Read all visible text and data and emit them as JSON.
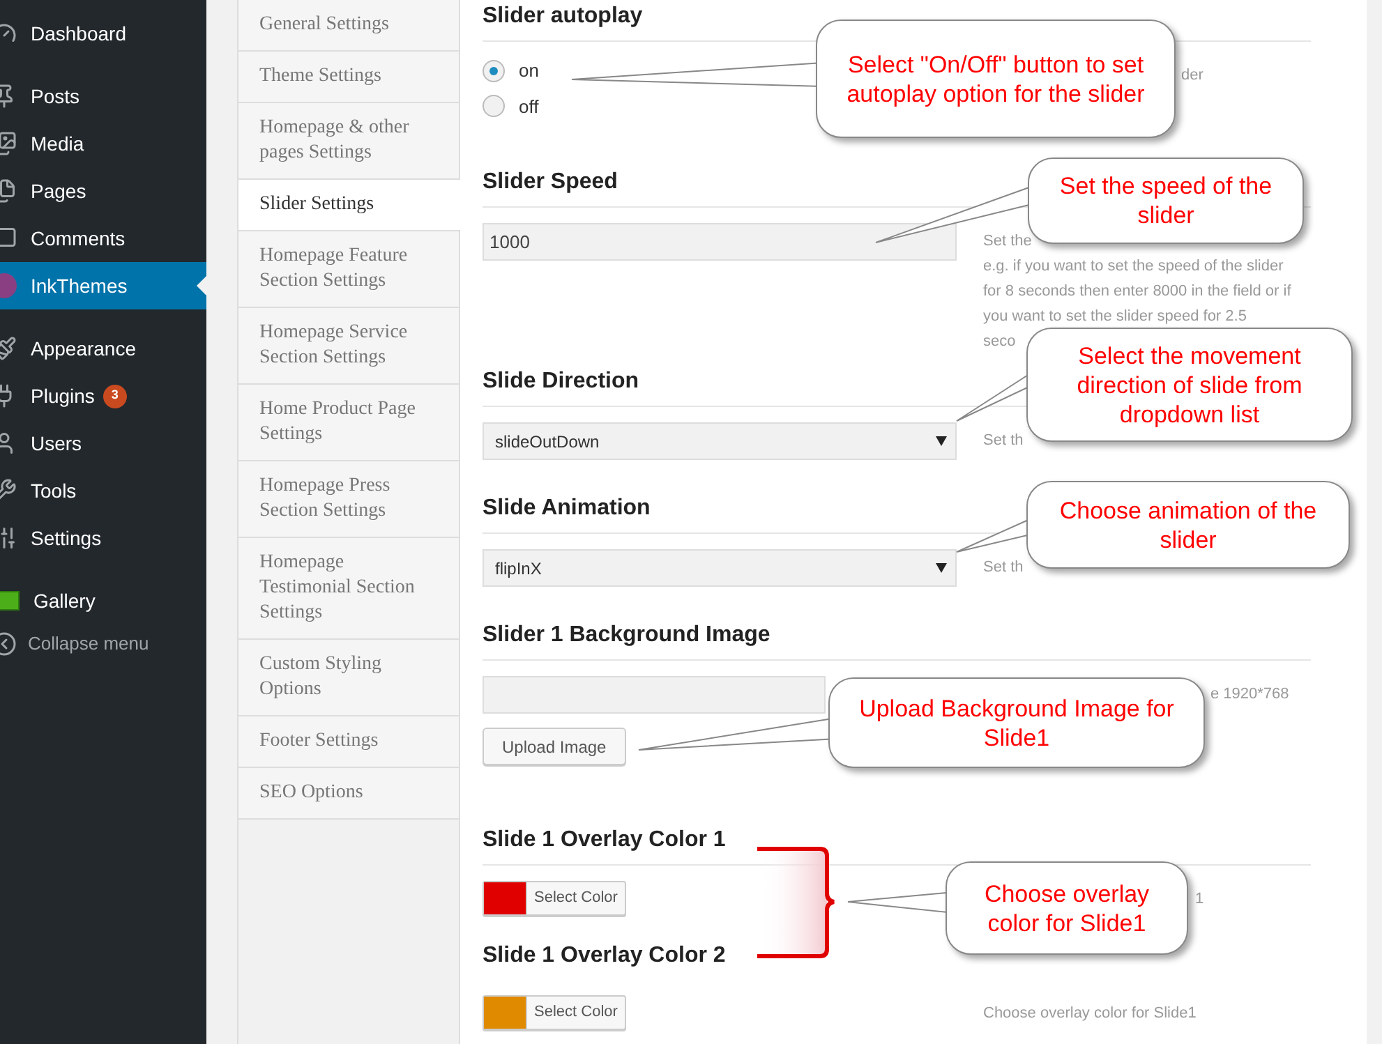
{
  "sidebar": {
    "groups": [
      [
        {
          "label": "Dashboard",
          "selected": false
        }
      ],
      [
        {
          "label": "Posts",
          "selected": false
        },
        {
          "label": "Media",
          "selected": false
        },
        {
          "label": "Pages",
          "selected": false
        },
        {
          "label": "Comments",
          "selected": false
        },
        {
          "label": "InkThemes",
          "selected": true
        }
      ],
      [
        {
          "label": "Appearance",
          "selected": false
        },
        {
          "label": "Plugins",
          "selected": false,
          "badge": "3"
        },
        {
          "label": "Users",
          "selected": false
        },
        {
          "label": "Tools",
          "selected": false
        },
        {
          "label": "Settings",
          "selected": false
        }
      ],
      [
        {
          "label": "Gallery",
          "selected": false
        }
      ]
    ],
    "collapse": "Collapse menu"
  },
  "settings_tabs": [
    {
      "label": "General Settings",
      "selected": false
    },
    {
      "label": "Theme Settings",
      "selected": false
    },
    {
      "label": "Homepage & other pages Settings",
      "selected": false
    },
    {
      "label": "Slider Settings",
      "selected": true
    },
    {
      "label": "Homepage Feature Section Settings",
      "selected": false
    },
    {
      "label": "Homepage Service Section Settings",
      "selected": false
    },
    {
      "label": "Home Product Page Settings",
      "selected": false
    },
    {
      "label": "Homepage Press Section Settings",
      "selected": false
    },
    {
      "label": "Homepage Testimonial Section Settings",
      "selected": false
    },
    {
      "label": "Custom Styling Options",
      "selected": false
    },
    {
      "label": "Footer Settings",
      "selected": false
    },
    {
      "label": "SEO Options",
      "selected": false
    }
  ],
  "sections": [
    {
      "kind": "radio",
      "title": "Slider autoplay",
      "options": [
        {
          "label": "on",
          "selected": true
        },
        {
          "label": "off",
          "selected": false
        }
      ],
      "description": [
        "der"
      ]
    },
    {
      "kind": "text",
      "title": "Slider Speed",
      "value": "1000",
      "description": [
        "Set the",
        "e.g. if you want to set the speed of the slider",
        "for 8 seconds then enter 8000 in the field or if",
        "you want to set the slider speed for 2.5",
        "seco"
      ]
    },
    {
      "kind": "select",
      "title": "Slide Direction",
      "value": "slideOutDown",
      "description": [
        "Set th"
      ]
    },
    {
      "kind": "select",
      "title": "Slide Animation",
      "value": "flipInX",
      "description": [
        "Set th"
      ]
    },
    {
      "kind": "upload",
      "title": "Slider 1 Background Image",
      "button": "Upload Image",
      "description": [
        "e 1920*768"
      ]
    },
    {
      "kind": "color",
      "title": "Slide 1 Overlay Color 1",
      "color": "#e00000",
      "button": "Select Color",
      "description": [
        "1"
      ]
    },
    {
      "kind": "color",
      "title": "Slide 1 Overlay Color 2",
      "color": "#e08a00",
      "button": "Select Color",
      "description": [
        "Choose overlay color for Slide1"
      ]
    }
  ],
  "callouts": [
    {
      "text": "Select \"On/Off\" button to set autoplay option for the slider"
    },
    {
      "text": "Set the speed of the slider"
    },
    {
      "text": "Select the movement direction of slide from dropdown list"
    },
    {
      "text": "Choose animation of the slider"
    },
    {
      "text": "Upload Background Image for Slide1"
    },
    {
      "text": "Choose overlay color for Slide1"
    }
  ]
}
